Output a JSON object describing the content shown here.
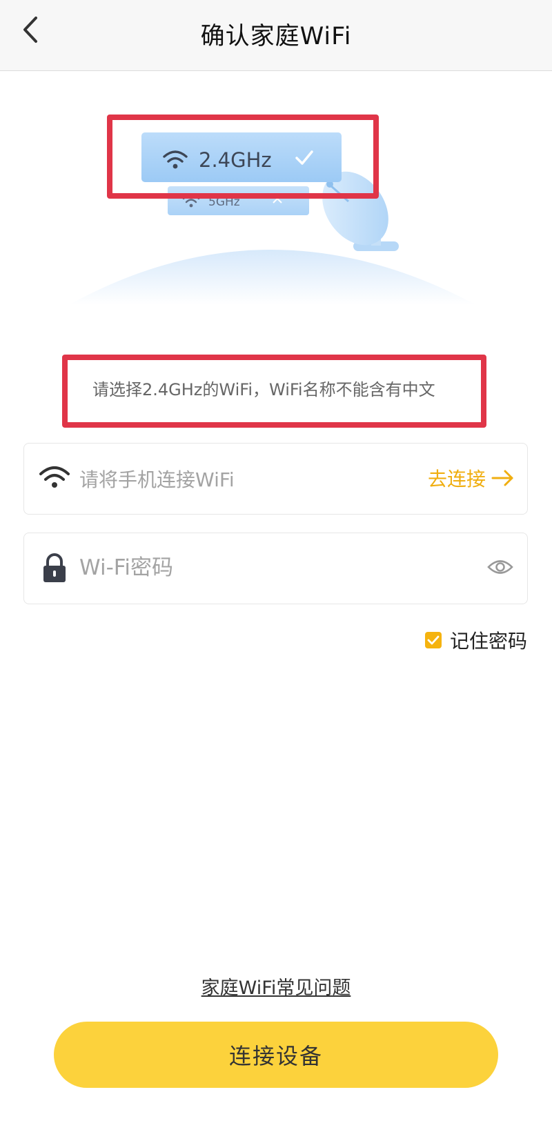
{
  "header": {
    "title": "确认家庭WiFi",
    "back_icon": "chevron-left-icon"
  },
  "illustration": {
    "band_24": "2.4GHz",
    "band_5": "5GHz",
    "selected": "2.4GHz"
  },
  "hint": "请选择2.4GHz的WiFi，WiFi名称不能含有中文",
  "wifi_field": {
    "placeholder": "请将手机连接WiFi",
    "action_label": "去连接",
    "icon": "wifi-icon",
    "action_icon": "arrow-right-icon"
  },
  "password_field": {
    "placeholder": "Wi-Fi密码",
    "value": "",
    "icon": "lock-icon",
    "toggle_icon": "eye-icon"
  },
  "remember": {
    "label": "记住密码",
    "checked": true
  },
  "faq_link": "家庭WiFi常见问题",
  "primary_button": "连接设备",
  "colors": {
    "accent": "#f0ae10",
    "button": "#fcd23c",
    "highlight_border": "#e03548"
  }
}
